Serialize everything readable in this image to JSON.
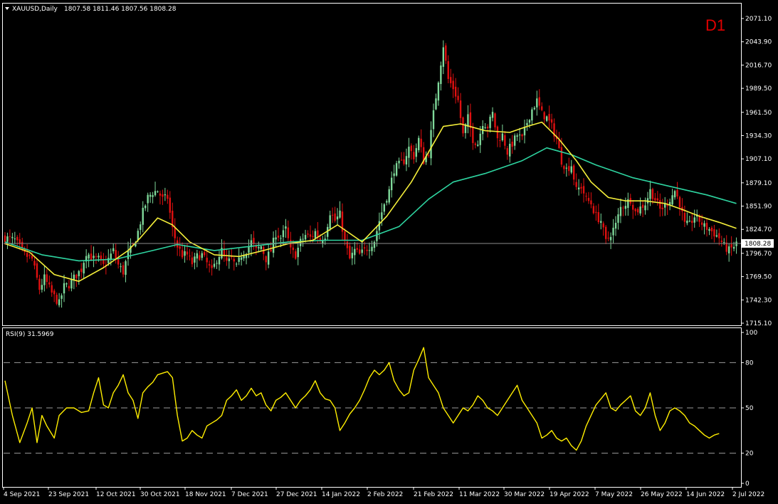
{
  "header": {
    "symbol": "XAUUSD,Daily",
    "ohlc": "1807.58 1811.46 1807.56 1808.28"
  },
  "timeframe_badge": "D1",
  "colors": {
    "background": "#000000",
    "grid_border": "#ffffff",
    "bull_candle": "#7fd99a",
    "bear_candle": "#e01010",
    "ma_fast": "#f5ef3a",
    "ma_slow": "#2ed4a0",
    "rsi_line": "#ffee00",
    "bid_line": "#8c8c8c"
  },
  "chart_data": [
    {
      "type": "candlestick",
      "name": "price",
      "ylim": [
        1715.1,
        2081.0
      ],
      "y_ticks": [
        "2071.10",
        "2043.90",
        "2016.70",
        "1989.50",
        "1961.50",
        "1934.30",
        "1907.10",
        "1879.10",
        "1851.90",
        "1824.70",
        "1796.70",
        "1769.50",
        "1742.30",
        "1715.10"
      ],
      "current_price": "1808.28",
      "x_ticks": [
        "4 Sep 2021",
        "23 Sep 2021",
        "12 Oct 2021",
        "30 Oct 2021",
        "18 Nov 2021",
        "7 Dec 2021",
        "27 Dec 2021",
        "14 Jan 2022",
        "2 Feb 2022",
        "21 Feb 2022",
        "11 Mar 2022",
        "30 Mar 2022",
        "19 Apr 2022",
        "7 May 2022",
        "26 May 2022",
        "14 Jun 2022",
        "2 Jul 2022"
      ],
      "close_path": [
        [
          0,
          1815
        ],
        [
          4,
          1812
        ],
        [
          8,
          1795
        ],
        [
          11,
          1790
        ],
        [
          14,
          1755
        ],
        [
          16,
          1768
        ],
        [
          19,
          1750
        ],
        [
          22,
          1738
        ],
        [
          24,
          1758
        ],
        [
          26,
          1760
        ],
        [
          28,
          1768
        ],
        [
          31,
          1778
        ],
        [
          33,
          1798
        ],
        [
          36,
          1790
        ],
        [
          38,
          1790
        ],
        [
          40,
          1782
        ],
        [
          42,
          1790
        ],
        [
          44,
          1800
        ],
        [
          46,
          1783
        ],
        [
          48,
          1775
        ],
        [
          50,
          1797
        ],
        [
          52,
          1805
        ],
        [
          54,
          1822
        ],
        [
          56,
          1845
        ],
        [
          58,
          1862
        ],
        [
          60,
          1868
        ],
        [
          62,
          1870
        ],
        [
          64,
          1860
        ],
        [
          66,
          1862
        ],
        [
          68,
          1825
        ],
        [
          70,
          1805
        ],
        [
          72,
          1795
        ],
        [
          74,
          1795
        ],
        [
          76,
          1785
        ],
        [
          78,
          1793
        ],
        [
          80,
          1795
        ],
        [
          82,
          1785
        ],
        [
          84,
          1775
        ],
        [
          86,
          1790
        ],
        [
          88,
          1800
        ],
        [
          90,
          1785
        ],
        [
          92,
          1790
        ],
        [
          94,
          1780
        ],
        [
          96,
          1795
        ],
        [
          98,
          1800
        ],
        [
          100,
          1810
        ],
        [
          102,
          1800
        ],
        [
          104,
          1805
        ],
        [
          106,
          1790
        ],
        [
          108,
          1800
        ],
        [
          110,
          1820
        ],
        [
          112,
          1815
        ],
        [
          114,
          1825
        ],
        [
          116,
          1800
        ],
        [
          118,
          1795
        ],
        [
          120,
          1810
        ],
        [
          122,
          1818
        ],
        [
          124,
          1815
        ],
        [
          126,
          1822
        ],
        [
          128,
          1812
        ],
        [
          130,
          1818
        ],
        [
          132,
          1845
        ],
        [
          134,
          1835
        ],
        [
          136,
          1842
        ],
        [
          138,
          1810
        ],
        [
          140,
          1790
        ],
        [
          142,
          1800
        ],
        [
          144,
          1795
        ],
        [
          146,
          1800
        ],
        [
          148,
          1805
        ],
        [
          150,
          1812
        ],
        [
          152,
          1835
        ],
        [
          154,
          1855
        ],
        [
          156,
          1870
        ],
        [
          158,
          1895
        ],
        [
          160,
          1900
        ],
        [
          162,
          1905
        ],
        [
          164,
          1920
        ],
        [
          166,
          1910
        ],
        [
          168,
          1930
        ],
        [
          170,
          1905
        ],
        [
          172,
          1915
        ],
        [
          174,
          1960
        ],
        [
          176,
          2000
        ],
        [
          178,
          2040
        ],
        [
          180,
          2000
        ],
        [
          182,
          1990
        ],
        [
          184,
          1975
        ],
        [
          186,
          1935
        ],
        [
          188,
          1955
        ],
        [
          190,
          1930
        ],
        [
          192,
          1925
        ],
        [
          194,
          1950
        ],
        [
          196,
          1945
        ],
        [
          198,
          1960
        ],
        [
          200,
          1930
        ],
        [
          202,
          1935
        ],
        [
          204,
          1915
        ],
        [
          206,
          1925
        ],
        [
          208,
          1935
        ],
        [
          210,
          1930
        ],
        [
          212,
          1950
        ],
        [
          214,
          1965
        ],
        [
          216,
          1975
        ],
        [
          218,
          1960
        ],
        [
          220,
          1955
        ],
        [
          222,
          1945
        ],
        [
          224,
          1930
        ],
        [
          226,
          1905
        ],
        [
          228,
          1895
        ],
        [
          230,
          1900
        ],
        [
          232,
          1870
        ],
        [
          234,
          1875
        ],
        [
          236,
          1860
        ],
        [
          238,
          1855
        ],
        [
          240,
          1840
        ],
        [
          242,
          1835
        ],
        [
          244,
          1810
        ],
        [
          246,
          1820
        ],
        [
          248,
          1830
        ],
        [
          250,
          1850
        ],
        [
          252,
          1855
        ],
        [
          254,
          1860
        ],
        [
          256,
          1845
        ],
        [
          258,
          1850
        ],
        [
          260,
          1855
        ],
        [
          262,
          1870
        ],
        [
          264,
          1860
        ],
        [
          266,
          1848
        ],
        [
          268,
          1852
        ],
        [
          270,
          1860
        ],
        [
          272,
          1870
        ],
        [
          274,
          1855
        ],
        [
          276,
          1830
        ],
        [
          278,
          1830
        ],
        [
          280,
          1840
        ],
        [
          282,
          1835
        ],
        [
          284,
          1828
        ],
        [
          286,
          1825
        ],
        [
          288,
          1820
        ],
        [
          290,
          1815
        ],
        [
          292,
          1805
        ],
        [
          294,
          1800
        ],
        [
          296,
          1805
        ],
        [
          297,
          1808
        ]
      ],
      "ma_fast": [
        [
          0,
          1808
        ],
        [
          10,
          1798
        ],
        [
          20,
          1772
        ],
        [
          30,
          1764
        ],
        [
          40,
          1780
        ],
        [
          50,
          1800
        ],
        [
          55,
          1815
        ],
        [
          62,
          1838
        ],
        [
          68,
          1830
        ],
        [
          75,
          1810
        ],
        [
          85,
          1795
        ],
        [
          95,
          1793
        ],
        [
          105,
          1800
        ],
        [
          115,
          1808
        ],
        [
          125,
          1812
        ],
        [
          135,
          1830
        ],
        [
          145,
          1810
        ],
        [
          155,
          1840
        ],
        [
          165,
          1880
        ],
        [
          172,
          1915
        ],
        [
          178,
          1945
        ],
        [
          185,
          1948
        ],
        [
          195,
          1940
        ],
        [
          205,
          1938
        ],
        [
          212,
          1945
        ],
        [
          218,
          1950
        ],
        [
          225,
          1930
        ],
        [
          232,
          1905
        ],
        [
          238,
          1880
        ],
        [
          245,
          1862
        ],
        [
          252,
          1858
        ],
        [
          260,
          1858
        ],
        [
          268,
          1855
        ],
        [
          275,
          1848
        ],
        [
          282,
          1840
        ],
        [
          290,
          1833
        ],
        [
          297,
          1826
        ]
      ],
      "ma_slow": [
        [
          0,
          1810
        ],
        [
          15,
          1795
        ],
        [
          30,
          1788
        ],
        [
          45,
          1790
        ],
        [
          60,
          1800
        ],
        [
          70,
          1807
        ],
        [
          85,
          1800
        ],
        [
          100,
          1805
        ],
        [
          115,
          1810
        ],
        [
          130,
          1812
        ],
        [
          145,
          1812
        ],
        [
          160,
          1828
        ],
        [
          172,
          1860
        ],
        [
          182,
          1880
        ],
        [
          195,
          1890
        ],
        [
          210,
          1905
        ],
        [
          220,
          1920
        ],
        [
          230,
          1912
        ],
        [
          240,
          1900
        ],
        [
          255,
          1885
        ],
        [
          270,
          1875
        ],
        [
          285,
          1865
        ],
        [
          297,
          1855
        ]
      ]
    },
    {
      "type": "line",
      "name": "RSI(9)",
      "title_value": "31.5969",
      "ylim": [
        0,
        100
      ],
      "y_ticks": [
        "100",
        "80",
        "50",
        "20",
        "0"
      ],
      "levels": [
        80,
        50,
        20
      ],
      "values": [
        [
          0,
          68
        ],
        [
          3,
          45
        ],
        [
          6,
          27
        ],
        [
          9,
          40
        ],
        [
          11,
          50
        ],
        [
          13,
          27
        ],
        [
          15,
          45
        ],
        [
          17,
          38
        ],
        [
          20,
          30
        ],
        [
          22,
          45
        ],
        [
          25,
          50
        ],
        [
          28,
          50
        ],
        [
          31,
          47
        ],
        [
          34,
          48
        ],
        [
          36,
          60
        ],
        [
          38,
          70
        ],
        [
          40,
          52
        ],
        [
          42,
          50
        ],
        [
          44,
          60
        ],
        [
          46,
          65
        ],
        [
          48,
          72
        ],
        [
          50,
          60
        ],
        [
          52,
          55
        ],
        [
          54,
          43
        ],
        [
          56,
          60
        ],
        [
          58,
          64
        ],
        [
          60,
          67
        ],
        [
          62,
          72
        ],
        [
          64,
          73
        ],
        [
          66,
          74
        ],
        [
          68,
          70
        ],
        [
          70,
          45
        ],
        [
          72,
          28
        ],
        [
          74,
          30
        ],
        [
          76,
          35
        ],
        [
          78,
          32
        ],
        [
          80,
          30
        ],
        [
          82,
          38
        ],
        [
          84,
          40
        ],
        [
          86,
          42
        ],
        [
          88,
          45
        ],
        [
          90,
          55
        ],
        [
          92,
          58
        ],
        [
          94,
          62
        ],
        [
          96,
          55
        ],
        [
          98,
          58
        ],
        [
          100,
          63
        ],
        [
          102,
          58
        ],
        [
          104,
          60
        ],
        [
          106,
          52
        ],
        [
          108,
          48
        ],
        [
          110,
          55
        ],
        [
          112,
          57
        ],
        [
          114,
          60
        ],
        [
          116,
          55
        ],
        [
          118,
          50
        ],
        [
          120,
          55
        ],
        [
          122,
          58
        ],
        [
          124,
          62
        ],
        [
          126,
          68
        ],
        [
          128,
          60
        ],
        [
          130,
          56
        ],
        [
          132,
          55
        ],
        [
          134,
          50
        ],
        [
          136,
          35
        ],
        [
          138,
          40
        ],
        [
          140,
          46
        ],
        [
          142,
          50
        ],
        [
          144,
          55
        ],
        [
          146,
          62
        ],
        [
          148,
          70
        ],
        [
          150,
          75
        ],
        [
          152,
          72
        ],
        [
          154,
          75
        ],
        [
          156,
          80
        ],
        [
          158,
          68
        ],
        [
          160,
          62
        ],
        [
          162,
          58
        ],
        [
          164,
          60
        ],
        [
          166,
          75
        ],
        [
          168,
          82
        ],
        [
          170,
          90
        ],
        [
          172,
          70
        ],
        [
          174,
          65
        ],
        [
          176,
          60
        ],
        [
          178,
          50
        ],
        [
          180,
          45
        ],
        [
          182,
          40
        ],
        [
          184,
          45
        ],
        [
          186,
          50
        ],
        [
          188,
          48
        ],
        [
          190,
          52
        ],
        [
          192,
          58
        ],
        [
          194,
          55
        ],
        [
          196,
          50
        ],
        [
          198,
          48
        ],
        [
          200,
          45
        ],
        [
          202,
          50
        ],
        [
          204,
          55
        ],
        [
          206,
          60
        ],
        [
          208,
          65
        ],
        [
          210,
          55
        ],
        [
          212,
          50
        ],
        [
          214,
          45
        ],
        [
          216,
          40
        ],
        [
          218,
          30
        ],
        [
          220,
          32
        ],
        [
          222,
          35
        ],
        [
          224,
          30
        ],
        [
          226,
          28
        ],
        [
          228,
          30
        ],
        [
          230,
          25
        ],
        [
          232,
          22
        ],
        [
          234,
          28
        ],
        [
          236,
          38
        ],
        [
          238,
          45
        ],
        [
          240,
          52
        ],
        [
          242,
          56
        ],
        [
          244,
          60
        ],
        [
          246,
          50
        ],
        [
          248,
          48
        ],
        [
          250,
          52
        ],
        [
          252,
          55
        ],
        [
          254,
          58
        ],
        [
          256,
          48
        ],
        [
          258,
          45
        ],
        [
          260,
          50
        ],
        [
          262,
          60
        ],
        [
          264,
          45
        ],
        [
          266,
          35
        ],
        [
          268,
          40
        ],
        [
          270,
          48
        ],
        [
          272,
          50
        ],
        [
          274,
          48
        ],
        [
          276,
          45
        ],
        [
          278,
          40
        ],
        [
          280,
          38
        ],
        [
          282,
          35
        ],
        [
          284,
          32
        ],
        [
          286,
          30
        ],
        [
          288,
          32
        ],
        [
          290,
          33
        ]
      ]
    }
  ]
}
